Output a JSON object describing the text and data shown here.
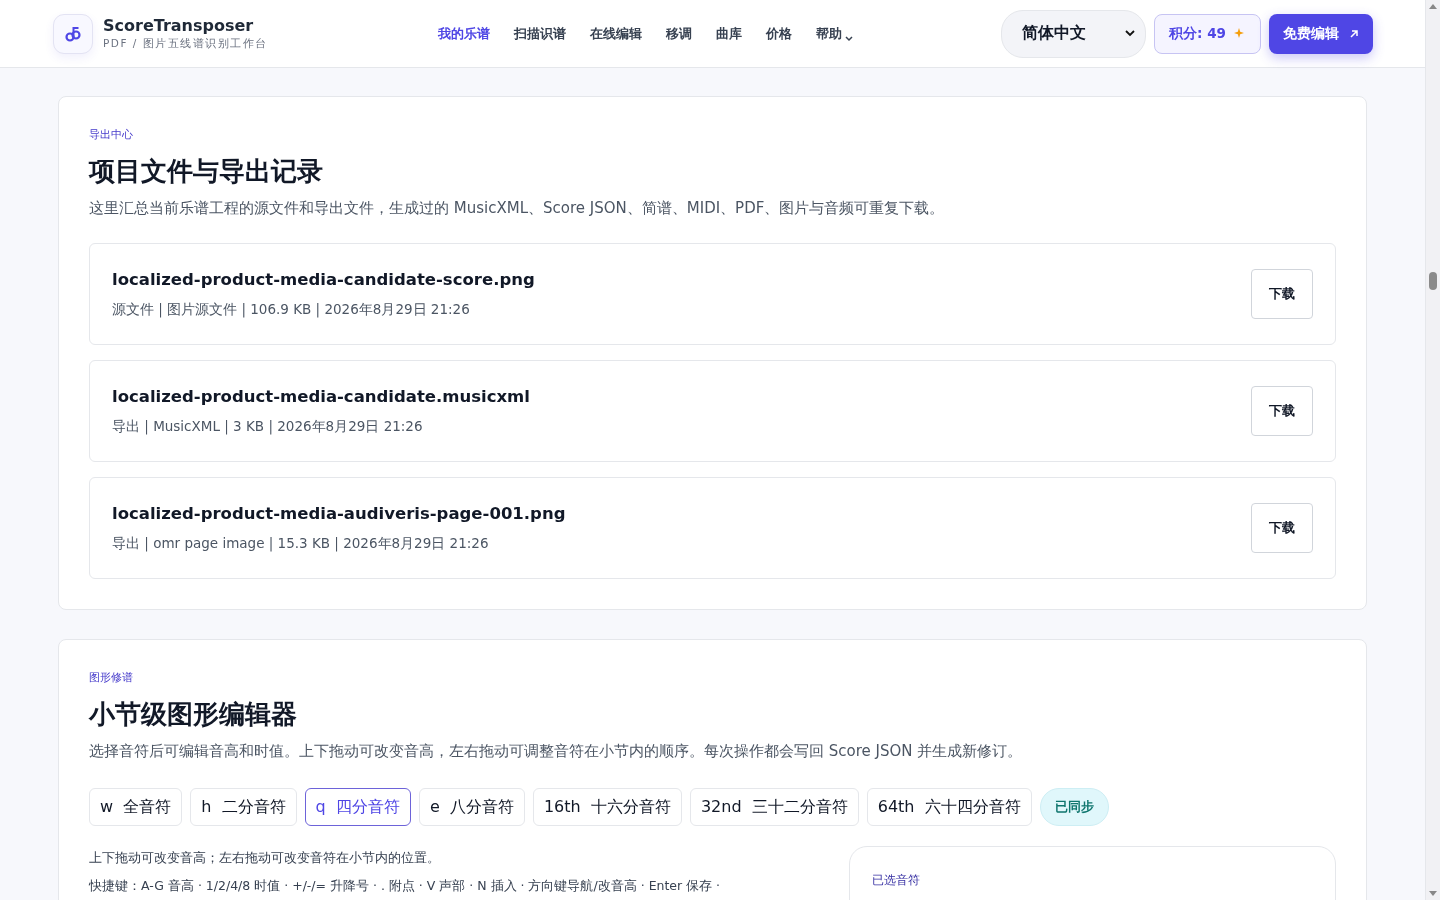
{
  "header": {
    "brand": "ScoreTransposer",
    "tagline": "PDF / 图片五线谱识别工作台",
    "nav": [
      {
        "label": "我的乐谱",
        "selected": true
      },
      {
        "label": "扫描识谱",
        "selected": false
      },
      {
        "label": "在线编辑",
        "selected": false
      },
      {
        "label": "移调",
        "selected": false
      },
      {
        "label": "曲库",
        "selected": false
      },
      {
        "label": "价格",
        "selected": false
      },
      {
        "label": "帮助",
        "selected": false,
        "kind": "dropdown"
      }
    ],
    "language": "简体中文",
    "points": "积分: 49",
    "cta": "免费编辑"
  },
  "export_section": {
    "eyebrow": "导出中心",
    "title": "项目文件与导出记录",
    "description": "这里汇总当前乐谱工程的源文件和导出文件，生成过的 MusicXML、Score JSON、简谱、MIDI、PDF、图片与音频可重复下载。",
    "files": [
      {
        "name": "localized-product-media-candidate-score.png",
        "meta": "源文件 | 图片源文件 | 106.9 KB | 2026年8月29日 21:26",
        "action": "下载"
      },
      {
        "name": "localized-product-media-candidate.musicxml",
        "meta": "导出 | MusicXML | 3 KB | 2026年8月29日 21:26",
        "action": "下载"
      },
      {
        "name": "localized-product-media-audiveris-page-001.png",
        "meta": "导出 | omr page image | 15.3 KB | 2026年8月29日 21:26",
        "action": "下载"
      }
    ]
  },
  "editor_section": {
    "eyebrow": "图形修谱",
    "title": "小节级图形编辑器",
    "description": "选择音符后可编辑音高和时值。上下拖动可改变音高，左右拖动可调整音符在小节内的顺序。每次操作都会写回 Score JSON 并生成新修订。",
    "durations": [
      {
        "key": "w",
        "label": "全音符",
        "selected": false
      },
      {
        "key": "h",
        "label": "二分音符",
        "selected": false
      },
      {
        "key": "q",
        "label": "四分音符",
        "selected": true
      },
      {
        "key": "e",
        "label": "八分音符",
        "selected": false
      },
      {
        "key": "16th",
        "label": "十六分音符",
        "selected": false
      },
      {
        "key": "32nd",
        "label": "三十二分音符",
        "selected": false
      },
      {
        "key": "64th",
        "label": "六十四分音符",
        "selected": false
      }
    ],
    "sync_status": "已同步",
    "hint": "上下拖动可改变音高；左右拖动可改变音符在小节内的位置。",
    "shortcuts": "快捷键：A-G 音高 · 1/2/4/8 时值 · +/-/= 升降号 · . 附点 · V 声部 · N 插入 · 方向键导航/改音高 · Enter 保存 ·",
    "selected_panel": {
      "title": "已选音符"
    }
  }
}
